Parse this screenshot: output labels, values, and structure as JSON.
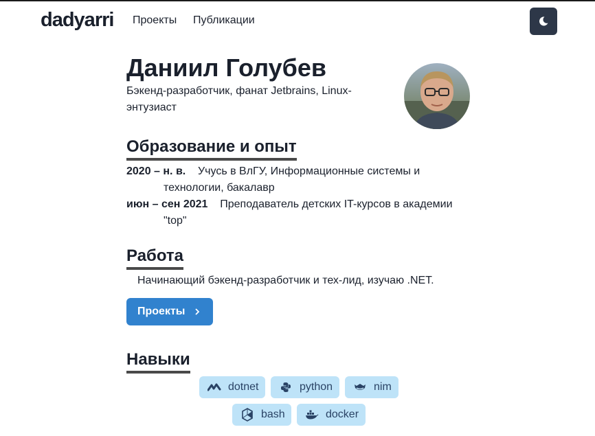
{
  "nav": {
    "brand": "dadyarri",
    "links": [
      "Проекты",
      "Публикации"
    ]
  },
  "profile": {
    "name": "Даниил Голубев",
    "subtitle": "Бэкенд-разработчик, фанат Jetbrains, Linux-энтузиаст"
  },
  "education": {
    "title": "Образование и опыт",
    "items": [
      {
        "when": "2020 – н. в.",
        "what": "Учусь в ВлГУ, Информационные системы и технологии, бакалавр"
      },
      {
        "when": "июн – сен 2021",
        "what": "Преподаватель детских IT-курсов в академии \"top\""
      }
    ]
  },
  "work": {
    "title": "Работа",
    "text": "Начинающий бэкенд-разработчик и тех-лид, изучаю .NET.",
    "button_label": "Проекты"
  },
  "skills": {
    "title": "Навыки",
    "tags": [
      {
        "label": "dotnet",
        "icon": "dotnet-icon"
      },
      {
        "label": "python",
        "icon": "python-icon"
      },
      {
        "label": "nim",
        "icon": "nim-icon"
      },
      {
        "label": "bash",
        "icon": "bash-icon"
      },
      {
        "label": "docker",
        "icon": "docker-icon"
      }
    ]
  },
  "colors": {
    "accent": "#3182ce",
    "tag_bg": "#bee3f8",
    "tag_text": "#2a4365",
    "theme_button": "#2d3748"
  }
}
